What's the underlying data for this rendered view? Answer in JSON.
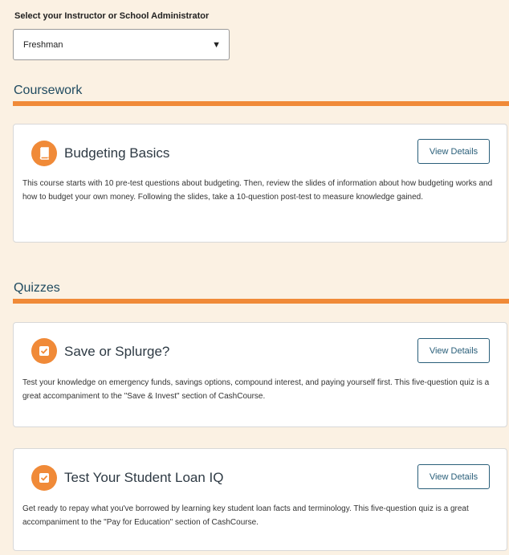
{
  "selector": {
    "label": "Select your Instructor or School Administrator",
    "value": "Freshman",
    "arrow": "▼"
  },
  "sections": {
    "coursework": {
      "heading": "Coursework"
    },
    "quizzes": {
      "heading": "Quizzes"
    }
  },
  "cards": [
    {
      "title": "Budgeting Basics",
      "icon": "book-icon",
      "button": "View Details",
      "description": "This course starts with 10 pre-test questions about budgeting. Then, review the slides of information about how budgeting works and how to budget your own money. Following the slides, take a 10-question post-test to measure knowledge gained."
    },
    {
      "title": "Save or Splurge?",
      "icon": "checkbox-icon",
      "button": "View Details",
      "description": "Test your knowledge on emergency funds, savings options, compound interest, and paying yourself first. This five-question quiz is a great accompaniment to the \"Save & Invest\" section of CashCourse."
    },
    {
      "title": "Test Your Student Loan IQ",
      "icon": "checkbox-icon",
      "button": "View Details",
      "description": "Get ready to repay what you've borrowed by learning key student loan facts and terminology. This five-question quiz is a great accompaniment to the \"Pay for Education\" section of CashCourse."
    }
  ],
  "colors": {
    "page_background": "#fbf1e3",
    "accent_orange": "#f08a38",
    "heading_teal": "#1f4a60",
    "button_border": "#2a5f7a"
  }
}
